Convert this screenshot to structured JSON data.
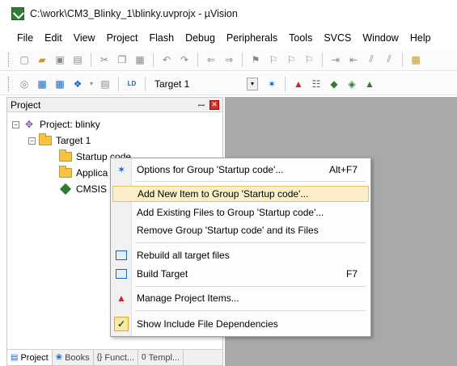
{
  "window": {
    "title": "C:\\work\\CM3_Blinky_1\\blinky.uvprojx - µVision"
  },
  "menu": [
    "File",
    "Edit",
    "View",
    "Project",
    "Flash",
    "Debug",
    "Peripherals",
    "Tools",
    "SVCS",
    "Window",
    "Help"
  ],
  "toolbar2": {
    "target": "Target 1"
  },
  "project_pane": {
    "title": "Project",
    "pin": "ꟷ",
    "tree": [
      {
        "label": "Project: blinky",
        "icon": "project-icon",
        "expander": "−"
      },
      {
        "label": "Target 1",
        "icon": "target-folder-icon",
        "expander": "−"
      },
      {
        "label": "Startup code",
        "icon": "folder-icon"
      },
      {
        "label": "Applica",
        "icon": "folder-icon"
      },
      {
        "label": "CMSIS",
        "icon": "green-diamond-icon"
      }
    ],
    "tabs": [
      {
        "label": "Project",
        "icon": "project-tab-icon"
      },
      {
        "label": "Books",
        "icon": "books-icon"
      },
      {
        "label": "Funct...",
        "icon": "functions-icon"
      },
      {
        "label": "Templ...",
        "icon": "templates-icon"
      }
    ]
  },
  "context_menu": {
    "items": [
      {
        "label": "Options for Group 'Startup code'...",
        "shortcut": "Alt+F7",
        "icon": "options-wand-icon"
      },
      {
        "label": "Add New  Item to Group 'Startup code'...",
        "shortcut": "",
        "icon": "",
        "highlighted": true
      },
      {
        "label": "Add Existing Files to Group 'Startup code'...",
        "shortcut": "",
        "icon": ""
      },
      {
        "label": "Remove Group 'Startup code' and its Files",
        "shortcut": "",
        "icon": ""
      },
      {
        "label": "Rebuild all target files",
        "shortcut": "",
        "icon": "rebuild-icon"
      },
      {
        "label": "Build Target",
        "shortcut": "F7",
        "icon": "build-icon"
      },
      {
        "label": "Manage Project Items...",
        "shortcut": "",
        "icon": "manage-items-icon"
      },
      {
        "label": "Show Include File Dependencies",
        "shortcut": "",
        "icon": "checkmark-icon"
      }
    ]
  }
}
